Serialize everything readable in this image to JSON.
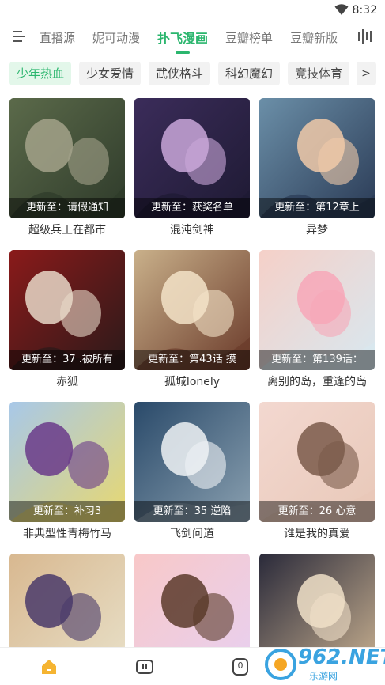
{
  "status_bar": {
    "time": "8:32",
    "wifi_icon": "wifi-icon"
  },
  "top_nav": {
    "menu_icon": "menu-icon",
    "tabs": [
      {
        "label": "直播源",
        "active": false
      },
      {
        "label": "妮可动漫",
        "active": false
      },
      {
        "label": "扑飞漫画",
        "active": true
      },
      {
        "label": "豆瓣榜单",
        "active": false
      },
      {
        "label": "豆瓣新版",
        "active": false
      }
    ],
    "right_icon": "bar-chart-icon"
  },
  "categories": {
    "chips": [
      {
        "label": "少年热血",
        "active": true
      },
      {
        "label": "少女爱情",
        "active": false
      },
      {
        "label": "武侠格斗",
        "active": false
      },
      {
        "label": "科幻魔幻",
        "active": false
      },
      {
        "label": "竞技体育",
        "active": false
      }
    ],
    "more_label": ">"
  },
  "comics": [
    {
      "update": "更新至：请假通知",
      "title": "超级兵王在都市",
      "colors": [
        "#5b6a4a",
        "#a3a28a",
        "#2e3a2a"
      ]
    },
    {
      "update": "更新至：获奖名单",
      "title": "混沌剑神",
      "colors": [
        "#3b2c5a",
        "#c9a7d9",
        "#1e1a33"
      ]
    },
    {
      "update": "更新至：第12章上",
      "title": "异梦",
      "colors": [
        "#6b8fa8",
        "#f0c9a8",
        "#2a3a55"
      ]
    },
    {
      "update": "更新至：37 .被所有",
      "title": "赤狐",
      "colors": [
        "#8a1a1a",
        "#e8d8c8",
        "#2a1a1a"
      ]
    },
    {
      "update": "更新至：第43话 摸",
      "title": "孤城lonely",
      "colors": [
        "#c9b08a",
        "#f3e3c8",
        "#6a3a2a"
      ]
    },
    {
      "update": "更新至：第139话：",
      "title": "离别的岛，重逢的岛",
      "colors": [
        "#f5d0c8",
        "#f7a7b8",
        "#d8e8f0"
      ]
    },
    {
      "update": "更新至：补习3",
      "title": "非典型性青梅竹马",
      "colors": [
        "#a8c8e8",
        "#6a3a8a",
        "#e8d870"
      ]
    },
    {
      "update": "更新至：35 逆陷",
      "title": "飞剑问道",
      "colors": [
        "#2a4a6a",
        "#eef2f5",
        "#8aa0b0"
      ]
    },
    {
      "update": "更新至：26 心意",
      "title": "谁是我的真爱",
      "colors": [
        "#f3d8d0",
        "#7a5a4a",
        "#e8c8b8"
      ]
    },
    {
      "colors": [
        "#d8b890",
        "#4a3a6a",
        "#e8e0c8"
      ]
    },
    {
      "colors": [
        "#f8c8c8",
        "#5a3a2a",
        "#e8d0f0"
      ]
    },
    {
      "colors": [
        "#2a2a3a",
        "#f0e0c8",
        "#c8b090"
      ]
    }
  ],
  "bottom_nav": {
    "items": [
      {
        "icon": "home-icon",
        "active": true
      },
      {
        "icon": "pause-icon",
        "active": false
      },
      {
        "icon": "zero-badge-icon",
        "active": false,
        "badge": "0"
      }
    ]
  },
  "watermark": {
    "main": "962.NET",
    "sub": "乐游网"
  },
  "colors": {
    "accent": "#2bb66e",
    "accent_bg": "#e3f7ea",
    "home_icon": "#f5b431"
  }
}
